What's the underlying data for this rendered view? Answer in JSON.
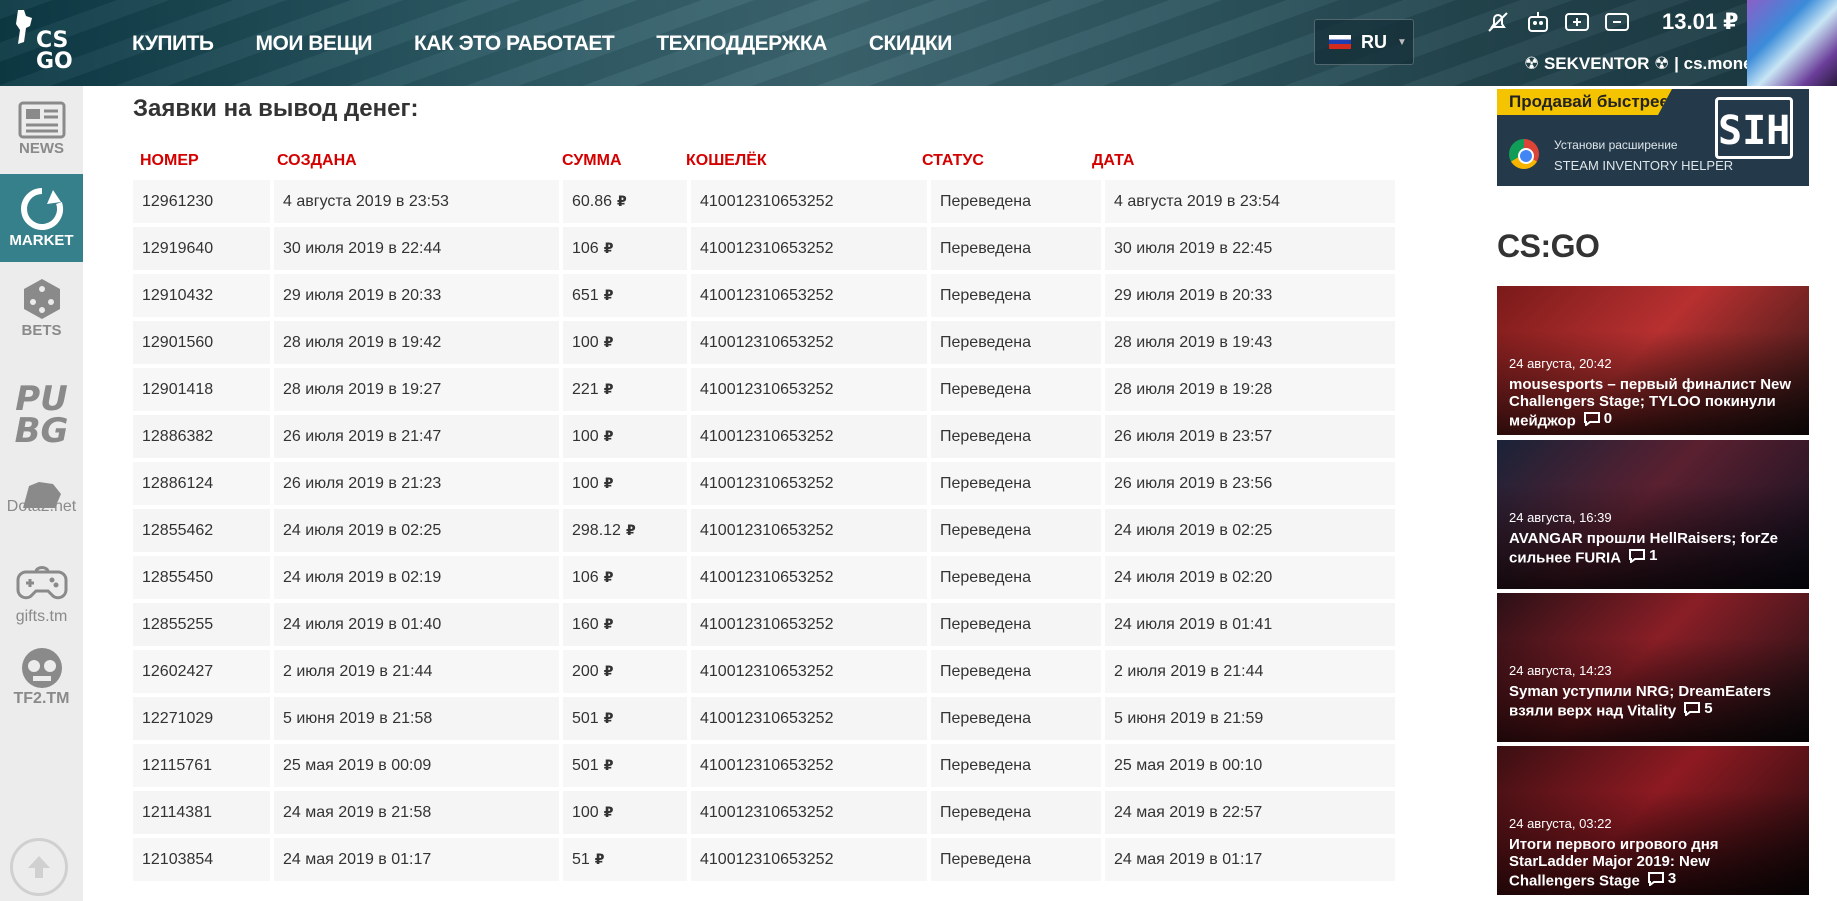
{
  "header": {
    "logo": "CS\nGO",
    "nav": [
      "КУПИТЬ",
      "МОИ ВЕЩИ",
      "КАК ЭТО РАБОТАЕТ",
      "ТЕХПОДДЕРЖКА",
      "СКИДКИ"
    ],
    "language": "RU",
    "balance": "13.01 ₽",
    "username": "☢ SEKVENTOR ☢ | cs.money"
  },
  "sidebar": {
    "items": [
      {
        "label": "NEWS",
        "icon": "newspaper-icon"
      },
      {
        "label": "MARKET",
        "icon": "market-refresh-icon"
      },
      {
        "label": "BETS",
        "icon": "dice-icon"
      },
      {
        "label": "PU\nBG",
        "icon": "pubg-logo"
      },
      {
        "label": "Dota2.net",
        "icon": "dota2-logo"
      },
      {
        "label": "gifts.tm",
        "icon": "gamepad-icon"
      },
      {
        "label": "TF2.TM",
        "icon": "tf2-logo"
      }
    ]
  },
  "main": {
    "title": "Заявки на вывод денег:",
    "columns": [
      "НОМЕР",
      "СОЗДАНА",
      "СУММА",
      "КОШЕЛЁК",
      "СТАТУС",
      "ДАТА"
    ],
    "currency": "₽",
    "rows": [
      [
        "12961230",
        "4 августа 2019 в 23:53",
        "60.86",
        "410012310653252",
        "Переведена",
        "4 августа 2019 в 23:54"
      ],
      [
        "12919640",
        "30 июля 2019 в 22:44",
        "106",
        "410012310653252",
        "Переведена",
        "30 июля 2019 в 22:45"
      ],
      [
        "12910432",
        "29 июля 2019 в 20:33",
        "651",
        "410012310653252",
        "Переведена",
        "29 июля 2019 в 20:33"
      ],
      [
        "12901560",
        "28 июля 2019 в 19:42",
        "100",
        "410012310653252",
        "Переведена",
        "28 июля 2019 в 19:43"
      ],
      [
        "12901418",
        "28 июля 2019 в 19:27",
        "221",
        "410012310653252",
        "Переведена",
        "28 июля 2019 в 19:28"
      ],
      [
        "12886382",
        "26 июля 2019 в 21:47",
        "100",
        "410012310653252",
        "Переведена",
        "26 июля 2019 в 23:57"
      ],
      [
        "12886124",
        "26 июля 2019 в 21:23",
        "100",
        "410012310653252",
        "Переведена",
        "26 июля 2019 в 23:56"
      ],
      [
        "12855462",
        "24 июля 2019 в 02:25",
        "298.12",
        "410012310653252",
        "Переведена",
        "24 июля 2019 в 02:25"
      ],
      [
        "12855450",
        "24 июля 2019 в 02:19",
        "106",
        "410012310653252",
        "Переведена",
        "24 июля 2019 в 02:20"
      ],
      [
        "12855255",
        "24 июля 2019 в 01:40",
        "160",
        "410012310653252",
        "Переведена",
        "24 июля 2019 в 01:41"
      ],
      [
        "12602427",
        "2 июля 2019 в 21:44",
        "200",
        "410012310653252",
        "Переведена",
        "2 июля 2019 в 21:44"
      ],
      [
        "12271029",
        "5 июня 2019 в 21:58",
        "501",
        "410012310653252",
        "Переведена",
        "5 июня 2019 в 21:59"
      ],
      [
        "12115761",
        "25 мая 2019 в 00:09",
        "501",
        "410012310653252",
        "Переведена",
        "25 мая 2019 в 00:10"
      ],
      [
        "12114381",
        "24 мая 2019 в 21:58",
        "100",
        "410012310653252",
        "Переведена",
        "24 мая 2019 в 22:57"
      ],
      [
        "12103854",
        "24 мая 2019 в 01:17",
        "51",
        "410012310653252",
        "Переведена",
        "24 мая 2019 в 01:17"
      ]
    ]
  },
  "ad": {
    "banner": "Продавай быстрее",
    "line1": "Установи расширение",
    "line2": "STEAM INVENTORY HELPER",
    "logo": "SIH"
  },
  "news": {
    "title": "CS:GO",
    "items": [
      {
        "time": "24 августа, 20:42",
        "text": "mousesports – первый финалист New Challengers Stage; TYLOO покинули мейджор",
        "comments": "0",
        "bg": [
          "#7a1a1a",
          "#b83030",
          "#2a1515"
        ]
      },
      {
        "time": "24 августа, 16:39",
        "text": "AVANGAR прошли HellRaisers; forZe сильнее FURIA",
        "comments": "1",
        "bg": [
          "#1a2238",
          "#5a2030",
          "#0e1020"
        ]
      },
      {
        "time": "24 августа, 14:23",
        "text": "Syman уступили NRG; DreamEaters взяли верх над Vitality",
        "comments": "5",
        "bg": [
          "#2a1016",
          "#8a1e26",
          "#151015"
        ]
      },
      {
        "time": "24 августа, 03:22",
        "text": "Итоги первого игрового дня StarLadder Major 2019: New Challengers Stage",
        "comments": "3",
        "bg": [
          "#3a0f12",
          "#8e1a22",
          "#1a0a0c"
        ]
      }
    ]
  }
}
